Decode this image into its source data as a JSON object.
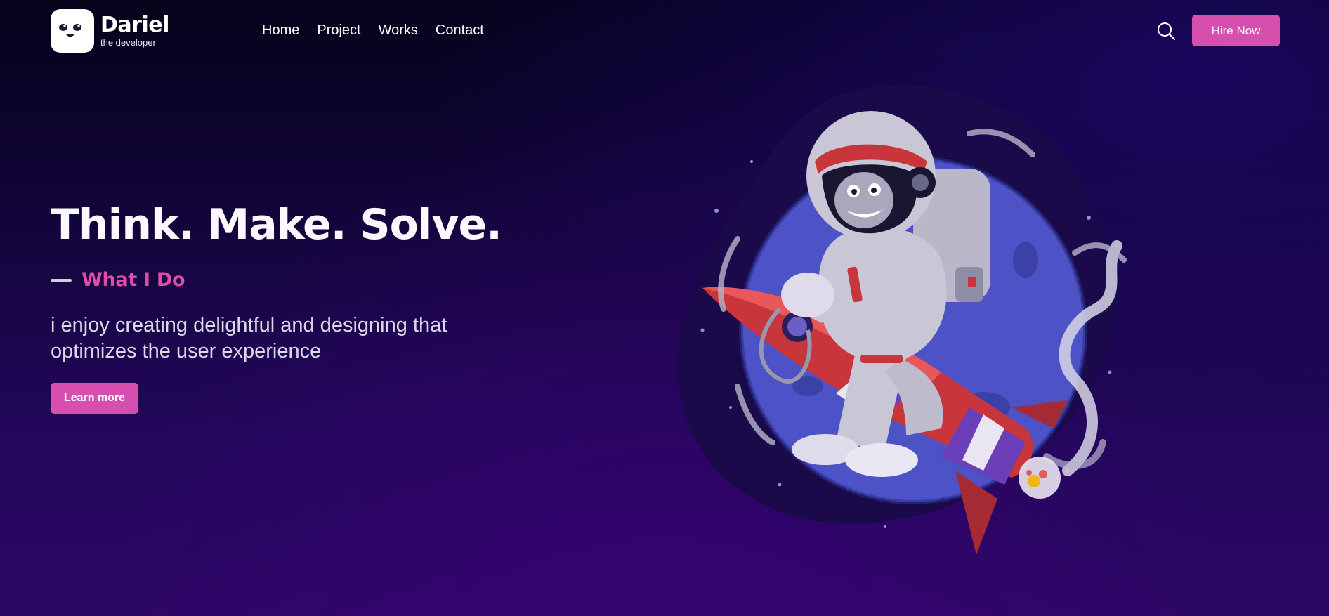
{
  "brand": {
    "name": "Dariel",
    "tagline": "the developer",
    "logo_icon": "smiley-face-icon"
  },
  "nav": {
    "items": [
      {
        "label": "Home"
      },
      {
        "label": "Project"
      },
      {
        "label": "Works"
      },
      {
        "label": "Contact"
      }
    ]
  },
  "header": {
    "search_icon": "search-icon",
    "hire_label": "Hire Now"
  },
  "hero": {
    "title": "Think. Make. Solve.",
    "subhead": "What I Do",
    "description": "i enjoy creating delightful and designing that optimizes the user experience",
    "cta_label": "Learn more",
    "illustration": "astronaut-riding-rocket-illustration"
  },
  "colors": {
    "accent": "#d64fae",
    "accent_text": "#e04ca8",
    "background_top": "#05021a",
    "background_bottom": "#2d0766",
    "planet": "#4d53c6"
  }
}
